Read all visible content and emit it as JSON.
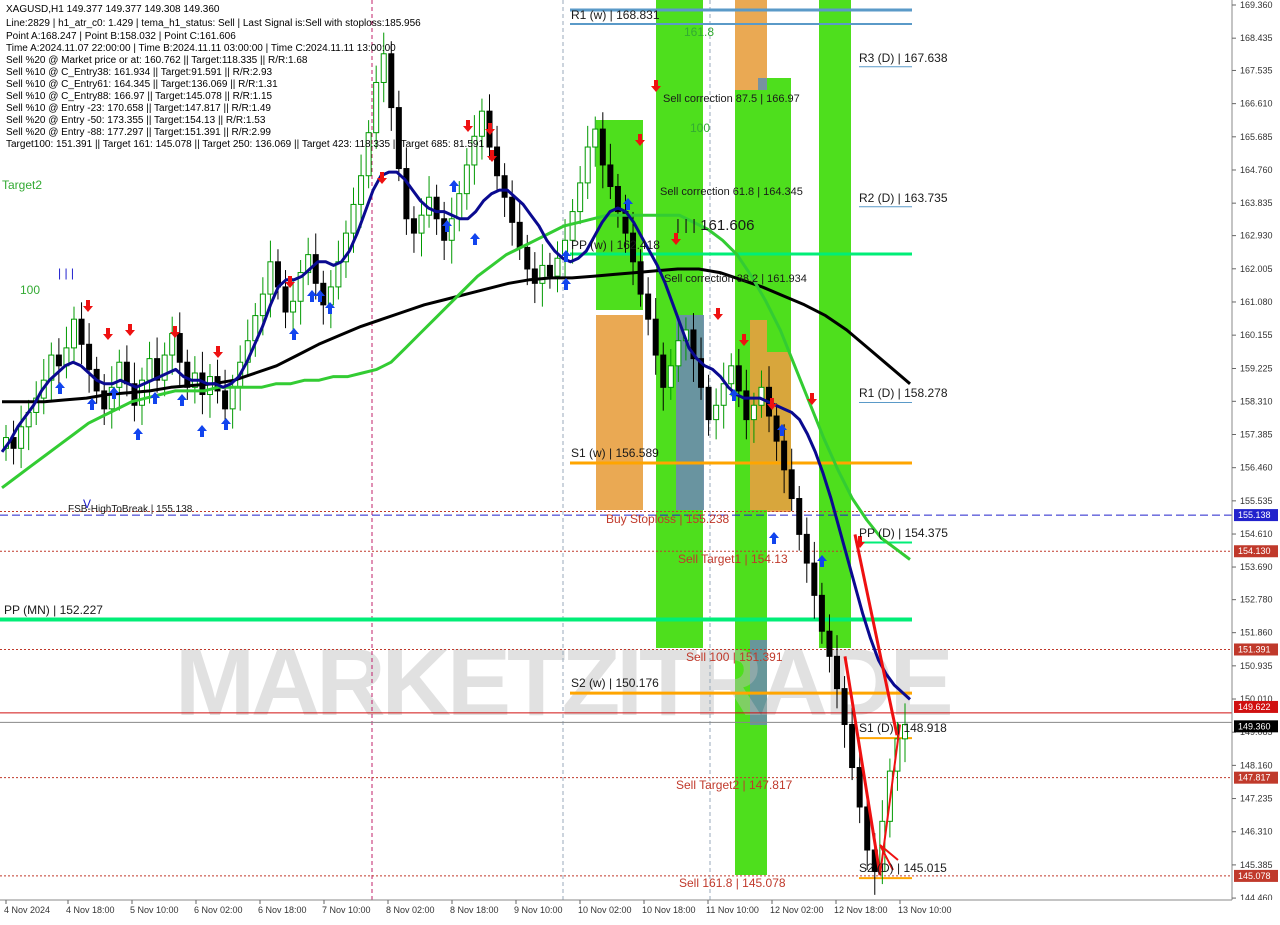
{
  "window": {
    "symbol_line": "XAGUSD,H1  149.377 149.377 149.308 149.360"
  },
  "info_lines": [
    "Line:2829  |  h1_atr_c0: 1.429  |  tema_h1_status: Sell  |  Last Signal is:Sell with stoploss:185.956",
    "Point A:168.247  |  Point B:158.032  |  Point C:161.606",
    "Time A:2024.11.07 22:00:00  |  Time B:2024.11.11 03:00:00  |  Time C:2024.11.11 13:00:00",
    "Sell %20 @ Market price or at: 160.762  ||  Target:118.335  ||  R/R:1.68",
    "Sell %10 @ C_Entry38: 161.934  ||  Target:91.591  ||  R/R:2.93",
    "Sell %10 @ C_Entry61: 164.345  ||  Target:136.069  ||  R/R:1.31",
    "Sell %10 @ C_Entry88: 166.97  ||  Target:145.078  ||  R/R:1.15",
    "Sell %10 @ Entry -23: 170.658  ||  Target:147.817  ||  R/R:1.49",
    "Sell %20 @ Entry -50: 173.355  ||  Target:154.13  ||  R/R:1.53",
    "Sell %20 @ Entry -88: 177.297  ||  Target:151.391  ||  R/R:2.99",
    "Target100: 151.391  ||  Target 161: 145.078  ||  Target 250: 136.069  ||  Target 423: 118.335  ||  Target 685: 81.591"
  ],
  "watermark": "MARKETZITRADE",
  "colors": {
    "green_band": "#44dd11",
    "orange_band": "#e8a040",
    "steel_band": "#6a8fa8",
    "pp_green": "#00ee77",
    "level_orange": "#ffa500",
    "weekly_blue": "#5a9ac8",
    "red_dotted": "#c0392b",
    "ma_black": "#000000",
    "ma_green": "#33cc33",
    "ma_navy": "#0a0a90",
    "bull_candle": "#009900",
    "bear_candle": "#000000"
  },
  "chart_data": {
    "type": "line",
    "symbol": "XAGUSD,H1",
    "ylim": [
      144.49,
      169.36
    ],
    "y_ticks": [
      "169.360",
      "168.435",
      "167.535",
      "166.610",
      "165.685",
      "164.760",
      "163.835",
      "162.930",
      "162.005",
      "161.080",
      "160.155",
      "159.225",
      "158.310",
      "157.385",
      "156.460",
      "155.535",
      "154.610",
      "153.690",
      "152.780",
      "151.860",
      "150.935",
      "150.010",
      "149.085",
      "148.160",
      "147.235",
      "146.310",
      "145.385",
      "144.460"
    ],
    "x_ticks": [
      "4 Nov 2024",
      "4 Nov 18:00",
      "5 Nov 10:00",
      "6 Nov 02:00",
      "6 Nov 18:00",
      "7 Nov 10:00",
      "8 Nov 02:00",
      "8 Nov 18:00",
      "9 Nov 10:00",
      "10 Nov 02:00",
      "10 Nov 18:00",
      "11 Nov 10:00",
      "12 Nov 02:00",
      "12 Nov 18:00",
      "13 Nov 10:00"
    ],
    "close": [
      157.3,
      157.0,
      157.6,
      158.0,
      158.4,
      158.9,
      159.6,
      159.3,
      159.8,
      160.6,
      159.9,
      159.2,
      158.6,
      158.1,
      158.7,
      159.4,
      158.8,
      158.2,
      158.9,
      159.5,
      158.9,
      159.6,
      160.2,
      159.4,
      158.7,
      159.1,
      158.5,
      159.0,
      158.6,
      158.1,
      158.7,
      159.4,
      160.0,
      160.7,
      161.3,
      162.2,
      161.5,
      160.8,
      161.1,
      161.9,
      162.4,
      161.6,
      161.0,
      161.5,
      162.2,
      163.0,
      163.8,
      164.6,
      165.8,
      167.2,
      168.0,
      166.5,
      164.8,
      163.4,
      163.0,
      163.5,
      164.0,
      163.4,
      162.8,
      163.4,
      164.1,
      164.9,
      165.7,
      166.4,
      165.4,
      164.6,
      164.0,
      163.3,
      162.6,
      162.0,
      161.6,
      162.1,
      161.8,
      162.3,
      162.8,
      163.6,
      164.4,
      165.4,
      165.9,
      164.9,
      164.3,
      163.6,
      163.0,
      162.2,
      161.3,
      160.6,
      159.6,
      158.7,
      159.3,
      160.0,
      160.3,
      159.5,
      158.7,
      157.8,
      158.2,
      158.8,
      159.3,
      158.6,
      157.8,
      158.2,
      158.7,
      157.9,
      157.2,
      156.4,
      155.6,
      154.6,
      153.8,
      152.9,
      151.9,
      151.2,
      150.3,
      149.3,
      148.1,
      147.0,
      145.8,
      145.2,
      146.6,
      148.0,
      148.9,
      149.3
    ],
    "ma_fast_navy": [
      156.9,
      157.2,
      157.6,
      157.9,
      158.2,
      158.6,
      158.9,
      159.1,
      159.3,
      159.4,
      159.3,
      159.1,
      158.9,
      158.8,
      158.8,
      158.9,
      158.8,
      158.7,
      158.8,
      158.9,
      159.0,
      159.1,
      159.2,
      159.0,
      158.9,
      158.9,
      158.8,
      158.8,
      158.7,
      158.8,
      159.0,
      159.4,
      159.9,
      160.4,
      161.0,
      161.5,
      161.7,
      161.7,
      161.8,
      162.0,
      162.2,
      162.2,
      162.1,
      162.2,
      162.5,
      163.0,
      163.6,
      164.2,
      164.6,
      164.7,
      164.7,
      164.5,
      164.2,
      163.9,
      163.7,
      163.6,
      163.6,
      163.5,
      163.4,
      163.4,
      163.6,
      163.9,
      164.1,
      164.2,
      164.2,
      164.0,
      163.8,
      163.5,
      163.2,
      162.8,
      162.5,
      162.3,
      162.2,
      162.3,
      162.5,
      162.9,
      163.3,
      163.6,
      163.7,
      163.6,
      163.3,
      162.9,
      162.5,
      162.1,
      161.6,
      161.0,
      160.4,
      159.8,
      159.5,
      159.3,
      159.2,
      159.0,
      158.7,
      158.5,
      158.4,
      158.4,
      158.4,
      158.3,
      158.2,
      158.1,
      158.0,
      157.8,
      157.4,
      156.9,
      156.3,
      155.6,
      154.8,
      154.0,
      153.2,
      152.4,
      151.7,
      151.1,
      150.7,
      150.4,
      150.2,
      150.0
    ],
    "ma_mid_green": [
      155.9,
      156.2,
      156.5,
      156.8,
      157.1,
      157.4,
      157.7,
      157.9,
      158.1,
      158.3,
      158.4,
      158.5,
      158.6,
      158.6,
      158.6,
      158.7,
      158.7,
      158.7,
      158.7,
      158.8,
      158.8,
      158.9,
      158.9,
      159.0,
      159.0,
      159.1,
      159.2,
      159.4,
      159.8,
      160.2,
      160.6,
      161.0,
      161.4,
      161.8,
      162.1,
      162.4,
      162.6,
      162.8,
      163.0,
      163.2,
      163.3,
      163.4,
      163.5,
      163.5,
      163.5,
      163.5,
      163.5,
      163.5,
      163.3,
      163.1,
      162.8,
      162.4,
      161.8,
      161.1,
      160.3,
      159.3,
      158.3,
      157.3,
      156.4,
      155.6,
      155.0,
      154.5,
      154.2,
      153.9
    ],
    "ma_slow_black": [
      158.3,
      158.3,
      158.3,
      158.35,
      158.4,
      158.5,
      158.55,
      158.6,
      158.7,
      158.75,
      158.8,
      158.9,
      159.1,
      159.3,
      159.6,
      159.9,
      160.15,
      160.4,
      160.6,
      160.8,
      161.0,
      161.15,
      161.3,
      161.45,
      161.6,
      161.7,
      161.75,
      161.75,
      161.8,
      161.85,
      161.9,
      161.95,
      162.0,
      162.0,
      161.9,
      161.7,
      161.5,
      161.25,
      161.0,
      160.7,
      160.3,
      159.8,
      159.3,
      158.8
    ]
  },
  "price_levels": [
    {
      "label": "R1 (w) | 168.831",
      "kind": "weekly"
    },
    {
      "label": "161.8",
      "kind": "fibo"
    },
    {
      "label": "R3 (D) | 167.638",
      "kind": "daily"
    },
    {
      "label": "Sell correction 87.5 | 166.97",
      "kind": "corr"
    },
    {
      "label": "100",
      "kind": "fibo"
    },
    {
      "label": "Sell correction 61.8 | 164.345",
      "kind": "corr"
    },
    {
      "label": "R2 (D) | 163.735",
      "kind": "daily"
    },
    {
      "label": "| | | 161.606",
      "kind": "pointc"
    },
    {
      "label": "PP (w) | 162.418",
      "kind": "pp"
    },
    {
      "label": "Sell correction 38.2 | 161.934",
      "kind": "corr"
    },
    {
      "label": "R1 (D) | 158.278",
      "kind": "daily"
    },
    {
      "label": "S1 (w) | 156.589",
      "kind": "weekly"
    },
    {
      "label": "FSB-HighToBreak | 155.138",
      "kind": "fsb"
    },
    {
      "label": "Buy Stoploss | 155.238",
      "kind": "red"
    },
    {
      "label": "PP (D) | 154.375",
      "kind": "daily"
    },
    {
      "label": "Sell Target1 | 154.13",
      "kind": "red"
    },
    {
      "label": "PP (MN) | 152.227",
      "kind": "pp"
    },
    {
      "label": "Sell 100 | 151.391",
      "kind": "red"
    },
    {
      "label": "S2 (w) | 150.176",
      "kind": "weekly"
    },
    {
      "label": "S1 (D) | 148.918",
      "kind": "daily"
    },
    {
      "label": "Sell Target2 | 147.817",
      "kind": "red"
    },
    {
      "label": "S2 (D) | 145.015",
      "kind": "daily"
    },
    {
      "label": "Sell 161.8 | 145.078",
      "kind": "red"
    }
  ],
  "side_labels": {
    "target2": "Target2",
    "hundred_left": "100",
    "bars": "| | |",
    "v_mark": "V"
  },
  "price_tags": [
    {
      "text": "155.138",
      "bg": "#2222cc"
    },
    {
      "text": "154.130",
      "bg": "#c0392b"
    },
    {
      "text": "151.391",
      "bg": "#c0392b"
    },
    {
      "text": "149.622",
      "bg": "#d01010"
    },
    {
      "text": "149.360",
      "bg": "#000000"
    },
    {
      "text": "147.817",
      "bg": "#c0392b"
    },
    {
      "text": "145.078",
      "bg": "#c0392b"
    }
  ]
}
